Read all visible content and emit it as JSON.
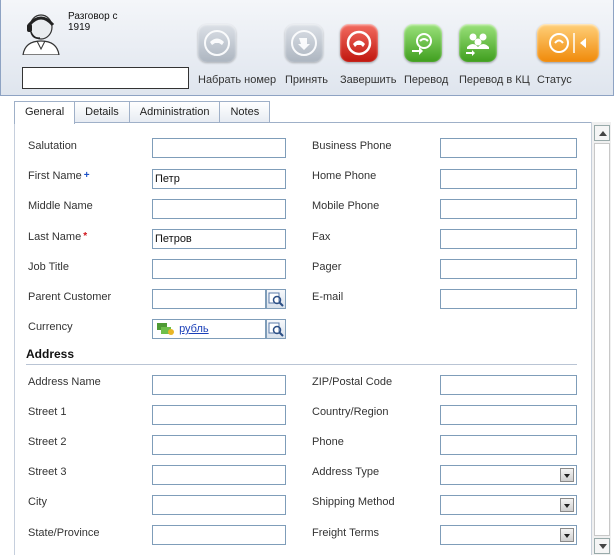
{
  "toolbar": {
    "call_status_line1": "Разговор с",
    "call_status_line2": "1919",
    "call_input_value": "",
    "buttons": [
      {
        "label": "Набрать номер",
        "icon": "phone-dial-icon",
        "color": "gray"
      },
      {
        "label": "Принять",
        "icon": "phone-accept-icon",
        "color": "gray"
      },
      {
        "label": "Завершить",
        "icon": "phone-hangup-icon",
        "color": "red"
      },
      {
        "label": "Перевод",
        "icon": "transfer-icon",
        "color": "green"
      },
      {
        "label": "Перевод в КЦ",
        "icon": "transfer-callcenter-icon",
        "color": "green"
      },
      {
        "label": "Статус",
        "icon": "status-icon",
        "color": "orange"
      }
    ]
  },
  "tabs": [
    "General",
    "Details",
    "Administration",
    "Notes"
  ],
  "active_tab": "General",
  "fields_left": {
    "salutation": {
      "label": "Salutation",
      "value": ""
    },
    "first_name": {
      "label": "First Name",
      "value": "Петр",
      "required_mark": "+"
    },
    "middle_name": {
      "label": "Middle Name",
      "value": ""
    },
    "last_name": {
      "label": "Last Name",
      "value": "Петров",
      "required_mark": "*"
    },
    "job_title": {
      "label": "Job Title",
      "value": ""
    },
    "parent_customer": {
      "label": "Parent Customer",
      "value": ""
    },
    "currency": {
      "label": "Currency",
      "value": "рубль"
    }
  },
  "fields_right": {
    "business_phone": {
      "label": "Business Phone",
      "value": ""
    },
    "home_phone": {
      "label": "Home Phone",
      "value": ""
    },
    "mobile_phone": {
      "label": "Mobile Phone",
      "value": ""
    },
    "fax": {
      "label": "Fax",
      "value": ""
    },
    "pager": {
      "label": "Pager",
      "value": ""
    },
    "email": {
      "label": "E-mail",
      "value": ""
    }
  },
  "address": {
    "title": "Address",
    "left": {
      "address_name": {
        "label": "Address Name",
        "value": ""
      },
      "street1": {
        "label": "Street 1",
        "value": ""
      },
      "street2": {
        "label": "Street 2",
        "value": ""
      },
      "street3": {
        "label": "Street 3",
        "value": ""
      },
      "city": {
        "label": "City",
        "value": ""
      },
      "state": {
        "label": "State/Province",
        "value": ""
      }
    },
    "right": {
      "zip": {
        "label": "ZIP/Postal Code",
        "value": ""
      },
      "country": {
        "label": "Country/Region",
        "value": ""
      },
      "phone": {
        "label": "Phone",
        "value": ""
      },
      "address_type": {
        "label": "Address Type",
        "value": ""
      },
      "shipping_method": {
        "label": "Shipping Method",
        "value": ""
      },
      "freight_terms": {
        "label": "Freight Terms",
        "value": ""
      }
    }
  },
  "colors": {
    "accent_blue": "#1a50c8",
    "required_red": "#d0141a",
    "link": "#1a3fb8",
    "hangup_red": "#c0160e",
    "transfer_green": "#3f9e1e",
    "status_orange": "#f08a0a"
  }
}
